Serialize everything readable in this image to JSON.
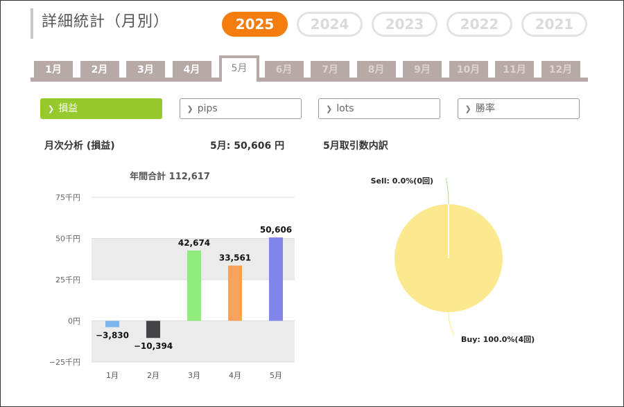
{
  "header": {
    "title": "詳細統計（月別）"
  },
  "years": [
    "2025",
    "2024",
    "2023",
    "2022",
    "2021"
  ],
  "active_year": "2025",
  "months": [
    "1月",
    "2月",
    "3月",
    "4月",
    "5月",
    "6月",
    "7月",
    "8月",
    "9月",
    "10月",
    "11月",
    "12月"
  ],
  "active_month": "5月",
  "metrics": [
    "損益",
    "pips",
    "lots",
    "勝率"
  ],
  "active_metric": "損益",
  "summary": {
    "section_title": "月次分析 (損益)",
    "month_result": "5月:  50,606 円",
    "breakdown_title": "5月取引数内訳"
  },
  "colors": {
    "accent": "#f57c0e",
    "active_metric": "#96c92d",
    "tab": "#b7a9a6"
  },
  "chart_data": [
    {
      "type": "bar",
      "title": "年間合計 112,617",
      "categories": [
        "1月",
        "2月",
        "3月",
        "4月",
        "5月"
      ],
      "values": [
        -3830,
        -10394,
        42674,
        33561,
        50606
      ],
      "data_labels": [
        "−3,830",
        "−10,394",
        "42,674",
        "33,561",
        "50,606"
      ],
      "bar_colors": [
        "#7cb5ec",
        "#434348",
        "#90ed7d",
        "#f7a35c",
        "#8085e9"
      ],
      "ylim": [
        -25000,
        75000
      ],
      "yticks": [
        75000,
        50000,
        25000,
        0,
        -25000
      ],
      "ytick_labels": [
        "75千円",
        "50千円",
        "25千円",
        "0円",
        "−25千円"
      ],
      "grid": true
    },
    {
      "type": "pie",
      "slices": [
        {
          "name": "Sell",
          "value": 0.0,
          "label": "Sell: 0.0%(0回)",
          "color": "#a8e08c"
        },
        {
          "name": "Buy",
          "value": 100.0,
          "label": "Buy: 100.0%(4回)",
          "color": "#fbe98f"
        }
      ]
    }
  ]
}
